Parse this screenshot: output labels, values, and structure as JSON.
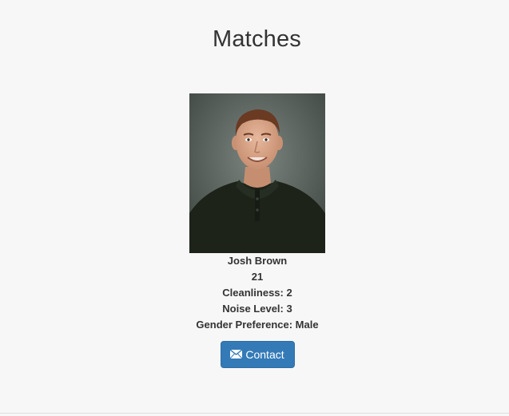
{
  "page": {
    "title": "Matches"
  },
  "match": {
    "name": "Josh Brown",
    "age": "21",
    "cleanliness": "Cleanliness: 2",
    "noise_level": "Noise Level: 3",
    "gender_preference": "Gender Preference: Male",
    "photo_icon": "profile-photo",
    "contact_label": "Contact",
    "contact_icon": "envelope-icon"
  },
  "colors": {
    "background": "#f7f7f7",
    "text": "#333333",
    "button": "#337ab7",
    "button_border": "#2e6da4",
    "photo_backdrop": "#5d6660",
    "sweater": "#1d2319",
    "skin": "#d7a58a",
    "hair": "#6a3a22"
  }
}
